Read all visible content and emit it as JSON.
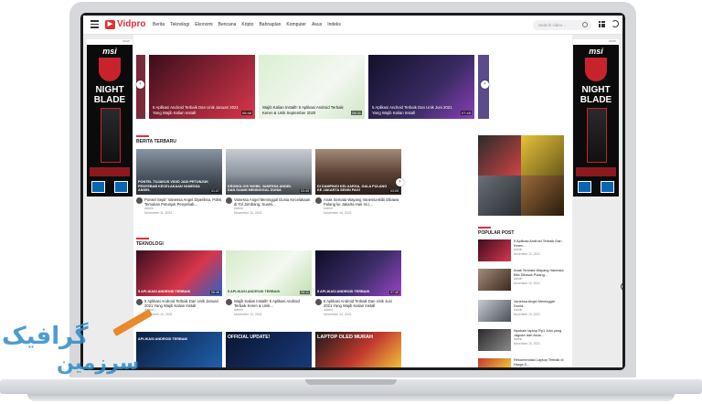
{
  "header": {
    "logo": "Vidpro",
    "nav": [
      "Berita",
      "Teknologi",
      "Ekonomi",
      "Bencana",
      "Kripto",
      "Bahnaplan",
      "Komputer",
      "Asus",
      "Indeks"
    ],
    "search_placeholder": "Search video..."
  },
  "ads": {
    "brand": "msi",
    "title_line1": "NIGHT",
    "title_line2": "BLADE",
    "close": "close"
  },
  "slider": [
    {
      "caption": "5 Aplikasi Android Terbaik Dan Unik Januari 2021 Yang Wajib Kalian Install",
      "duration": "06:48",
      "color": "#d9364b"
    },
    {
      "caption": "Wajib Kalian Install!! 5 Aplikasi Android Terbaik Keren & Unik September 2020",
      "duration": "06:11",
      "color": "#e2f0de"
    },
    {
      "caption": "5 Aplikasi Android Terbaik Dan Unik Juni 2021 Yang Wajib Kalian Install",
      "duration": "07:45",
      "color": "#3a2b63"
    }
  ],
  "sections": {
    "latest": "BERITA TERBARU",
    "tech": "TEKNOLOGI",
    "popular": "POPULAR POST"
  },
  "latest": [
    {
      "caption": "PONTEL TUJAKUS VIDIO JADI PETUNJUK PENYEBAB KECELAKAAN VANESSA ANGEL",
      "duration": "01:47",
      "title": "Ponsel Sepir' Vanessa Angel Diperiksa, Polisi Temukan Petunjuk Penyebab...",
      "author": "Admin",
      "date": "November 11, 2021"
    },
    {
      "caption": "KRONOLOGI MOBIL VANESSA ANGEL DAN SUAMI MENINGGAL DUNIA",
      "duration": "03:45",
      "title": "Vanessa Angel Meninggal Dunia Kecelakaan di Tol Jombang, Suami...",
      "author": "Admin",
      "date": "November 10, 2021"
    },
    {
      "caption": "DI DAMPINGI KELUARGA, GALA PULANG KE JAKARTA SENIN PAGI",
      "duration": "03:05",
      "title": "Anak Semata Wayang Vanessa-Bibi Dibawa Pulang ke Jakarta Hari Ini (...",
      "author": "Admin",
      "date": "November 10, 2021"
    }
  ],
  "tech": [
    {
      "caption": "5 APLIKASI ANDROID TERBAIK",
      "duration": "06:48",
      "title": "5 Aplikasi Android Terbaik Dan Unik Januari 2021 Yang Wajib Kalian Install",
      "author": "Admin",
      "date": "November 12, 2021"
    },
    {
      "caption": "5 APLIKASI ANDROID TERBAIK",
      "duration": "06:11",
      "title": "Wajib Kalian Install!! 5 Aplikasi Android Terbaik Keren & Unik...",
      "author": "Admin",
      "date": "November 12, 2021"
    },
    {
      "caption": "5 APLIKASI ANDROID TERBAIK",
      "duration": "07:45",
      "title": "5 Aplikasi Android Terbaik Dan Unik Juni 2021 Yang Wajib Kalian Install",
      "author": "Admin",
      "date": "November 12, 2021"
    }
  ],
  "bottom_row": [
    {
      "caption": "APLIKASI ANDROID TERBAIK"
    },
    {
      "caption": "OFFICIAL UPDATE!"
    },
    {
      "caption": "LAPTOP OLED MURAH"
    }
  ],
  "popular": [
    {
      "title": "5 Aplikasi Android Terbaik Dan Keren...",
      "author": "Admin",
      "date": "November 12, 2021"
    },
    {
      "title": "Anak Semata Wayang Vanessa Bibi Dibawa Pulang...",
      "author": "Admin",
      "date": "November 10, 2021"
    },
    {
      "title": "Vanessa Angel Meninggal Dunia...",
      "author": "Admin",
      "date": "November 10, 2021"
    },
    {
      "title": "Nyobain laptop Rp1 Juta yang Jagoan dari Asus...",
      "author": "Admin",
      "date": "November 10, 2021"
    },
    {
      "title": "Rekomendasi Laptop Terbaik di Harga 5...",
      "author": "Admin",
      "date": "November 11, 2021"
    }
  ],
  "watermark": {
    "line1": "گرافیک",
    "line2": "سرزمین"
  }
}
